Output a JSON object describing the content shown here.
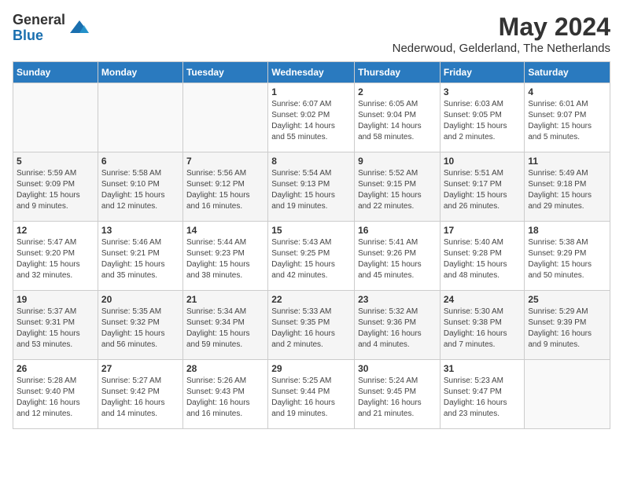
{
  "logo": {
    "general": "General",
    "blue": "Blue"
  },
  "title": {
    "month_year": "May 2024",
    "location": "Nederwoud, Gelderland, The Netherlands"
  },
  "weekdays": [
    "Sunday",
    "Monday",
    "Tuesday",
    "Wednesday",
    "Thursday",
    "Friday",
    "Saturday"
  ],
  "weeks": [
    [
      {
        "num": "",
        "info": ""
      },
      {
        "num": "",
        "info": ""
      },
      {
        "num": "",
        "info": ""
      },
      {
        "num": "1",
        "info": "Sunrise: 6:07 AM\nSunset: 9:02 PM\nDaylight: 14 hours\nand 55 minutes."
      },
      {
        "num": "2",
        "info": "Sunrise: 6:05 AM\nSunset: 9:04 PM\nDaylight: 14 hours\nand 58 minutes."
      },
      {
        "num": "3",
        "info": "Sunrise: 6:03 AM\nSunset: 9:05 PM\nDaylight: 15 hours\nand 2 minutes."
      },
      {
        "num": "4",
        "info": "Sunrise: 6:01 AM\nSunset: 9:07 PM\nDaylight: 15 hours\nand 5 minutes."
      }
    ],
    [
      {
        "num": "5",
        "info": "Sunrise: 5:59 AM\nSunset: 9:09 PM\nDaylight: 15 hours\nand 9 minutes."
      },
      {
        "num": "6",
        "info": "Sunrise: 5:58 AM\nSunset: 9:10 PM\nDaylight: 15 hours\nand 12 minutes."
      },
      {
        "num": "7",
        "info": "Sunrise: 5:56 AM\nSunset: 9:12 PM\nDaylight: 15 hours\nand 16 minutes."
      },
      {
        "num": "8",
        "info": "Sunrise: 5:54 AM\nSunset: 9:13 PM\nDaylight: 15 hours\nand 19 minutes."
      },
      {
        "num": "9",
        "info": "Sunrise: 5:52 AM\nSunset: 9:15 PM\nDaylight: 15 hours\nand 22 minutes."
      },
      {
        "num": "10",
        "info": "Sunrise: 5:51 AM\nSunset: 9:17 PM\nDaylight: 15 hours\nand 26 minutes."
      },
      {
        "num": "11",
        "info": "Sunrise: 5:49 AM\nSunset: 9:18 PM\nDaylight: 15 hours\nand 29 minutes."
      }
    ],
    [
      {
        "num": "12",
        "info": "Sunrise: 5:47 AM\nSunset: 9:20 PM\nDaylight: 15 hours\nand 32 minutes."
      },
      {
        "num": "13",
        "info": "Sunrise: 5:46 AM\nSunset: 9:21 PM\nDaylight: 15 hours\nand 35 minutes."
      },
      {
        "num": "14",
        "info": "Sunrise: 5:44 AM\nSunset: 9:23 PM\nDaylight: 15 hours\nand 38 minutes."
      },
      {
        "num": "15",
        "info": "Sunrise: 5:43 AM\nSunset: 9:25 PM\nDaylight: 15 hours\nand 42 minutes."
      },
      {
        "num": "16",
        "info": "Sunrise: 5:41 AM\nSunset: 9:26 PM\nDaylight: 15 hours\nand 45 minutes."
      },
      {
        "num": "17",
        "info": "Sunrise: 5:40 AM\nSunset: 9:28 PM\nDaylight: 15 hours\nand 48 minutes."
      },
      {
        "num": "18",
        "info": "Sunrise: 5:38 AM\nSunset: 9:29 PM\nDaylight: 15 hours\nand 50 minutes."
      }
    ],
    [
      {
        "num": "19",
        "info": "Sunrise: 5:37 AM\nSunset: 9:31 PM\nDaylight: 15 hours\nand 53 minutes."
      },
      {
        "num": "20",
        "info": "Sunrise: 5:35 AM\nSunset: 9:32 PM\nDaylight: 15 hours\nand 56 minutes."
      },
      {
        "num": "21",
        "info": "Sunrise: 5:34 AM\nSunset: 9:34 PM\nDaylight: 15 hours\nand 59 minutes."
      },
      {
        "num": "22",
        "info": "Sunrise: 5:33 AM\nSunset: 9:35 PM\nDaylight: 16 hours\nand 2 minutes."
      },
      {
        "num": "23",
        "info": "Sunrise: 5:32 AM\nSunset: 9:36 PM\nDaylight: 16 hours\nand 4 minutes."
      },
      {
        "num": "24",
        "info": "Sunrise: 5:30 AM\nSunset: 9:38 PM\nDaylight: 16 hours\nand 7 minutes."
      },
      {
        "num": "25",
        "info": "Sunrise: 5:29 AM\nSunset: 9:39 PM\nDaylight: 16 hours\nand 9 minutes."
      }
    ],
    [
      {
        "num": "26",
        "info": "Sunrise: 5:28 AM\nSunset: 9:40 PM\nDaylight: 16 hours\nand 12 minutes."
      },
      {
        "num": "27",
        "info": "Sunrise: 5:27 AM\nSunset: 9:42 PM\nDaylight: 16 hours\nand 14 minutes."
      },
      {
        "num": "28",
        "info": "Sunrise: 5:26 AM\nSunset: 9:43 PM\nDaylight: 16 hours\nand 16 minutes."
      },
      {
        "num": "29",
        "info": "Sunrise: 5:25 AM\nSunset: 9:44 PM\nDaylight: 16 hours\nand 19 minutes."
      },
      {
        "num": "30",
        "info": "Sunrise: 5:24 AM\nSunset: 9:45 PM\nDaylight: 16 hours\nand 21 minutes."
      },
      {
        "num": "31",
        "info": "Sunrise: 5:23 AM\nSunset: 9:47 PM\nDaylight: 16 hours\nand 23 minutes."
      },
      {
        "num": "",
        "info": ""
      }
    ]
  ]
}
